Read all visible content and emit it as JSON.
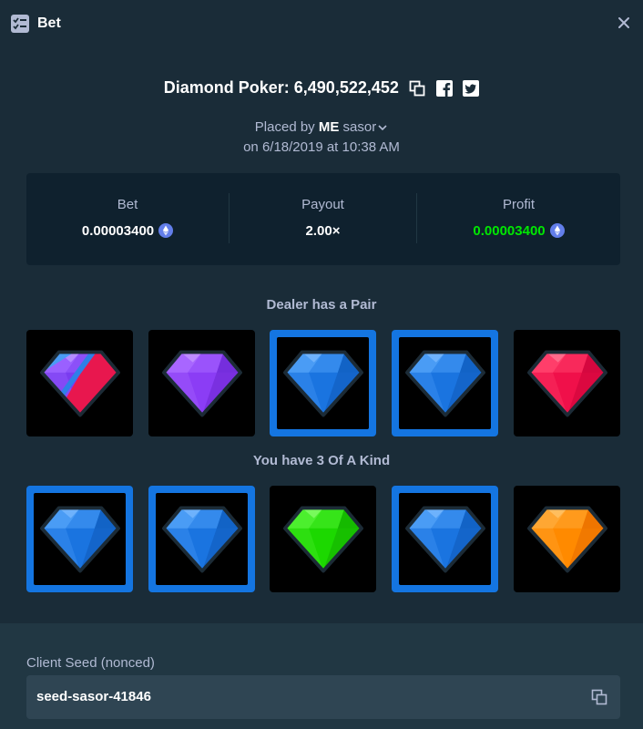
{
  "window": {
    "title": "Bet"
  },
  "bet": {
    "game_title": "Diamond Poker: 6,490,522,452",
    "placed_by_prefix": "Placed by",
    "user_badge": "ME",
    "username": "sasor",
    "placed_on": "on 6/18/2019 at 10:38 AM"
  },
  "stats": {
    "bet_label": "Bet",
    "bet_value": "0.00003400",
    "payout_label": "Payout",
    "payout_value": "2.00×",
    "profit_label": "Profit",
    "profit_value": "0.00003400",
    "currency_icon": "eth-icon",
    "profit_color": "#00e701"
  },
  "dealer": {
    "title": "Dealer has a Pair",
    "cards": [
      {
        "gem": "split-gem",
        "highlighted": false
      },
      {
        "gem": "purple-gem",
        "highlighted": false
      },
      {
        "gem": "blue-gem",
        "highlighted": true
      },
      {
        "gem": "blue-gem",
        "highlighted": true
      },
      {
        "gem": "red-gem",
        "highlighted": false
      }
    ]
  },
  "player": {
    "title": "You have 3 Of A Kind",
    "cards": [
      {
        "gem": "blue-gem",
        "highlighted": true
      },
      {
        "gem": "blue-gem",
        "highlighted": true
      },
      {
        "gem": "green-gem",
        "highlighted": false
      },
      {
        "gem": "blue-gem",
        "highlighted": true
      },
      {
        "gem": "orange-gem",
        "highlighted": false
      }
    ]
  },
  "seed": {
    "label": "Client Seed (nonced)",
    "value": "seed-sasor-41846"
  },
  "colors": {
    "background": "#1a2c38",
    "panel": "#0f212e",
    "footer": "#213743",
    "highlight": "#1475e1",
    "win_green": "#00e701"
  }
}
